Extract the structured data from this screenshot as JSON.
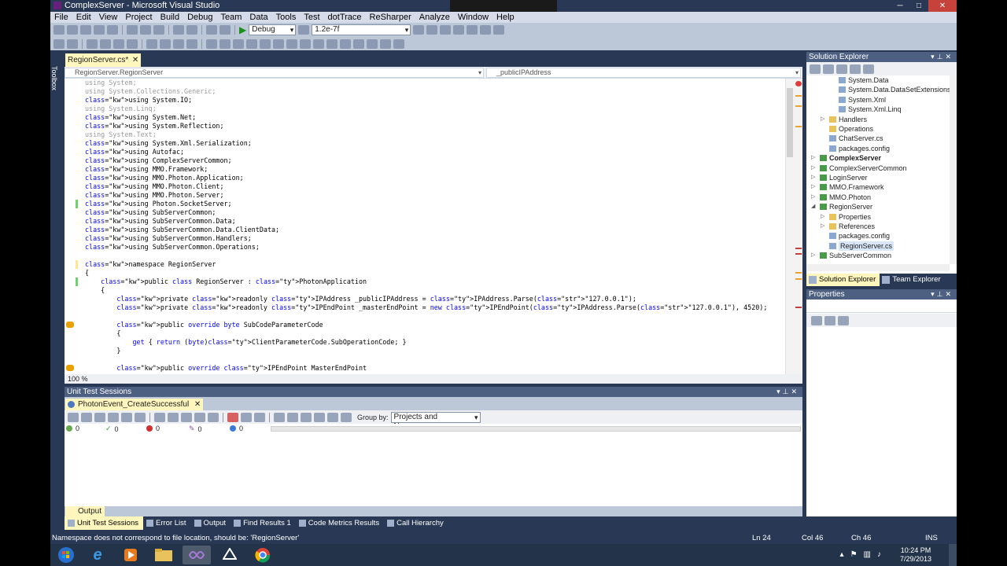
{
  "window": {
    "title": "ComplexServer - Microsoft Visual Studio"
  },
  "menu": [
    "File",
    "Edit",
    "View",
    "Project",
    "Build",
    "Debug",
    "Team",
    "Data",
    "Tools",
    "Test",
    "dotTrace",
    "ReSharper",
    "Analyze",
    "Window",
    "Help"
  ],
  "toolbar": {
    "config": "Debug",
    "search_value": "1.2e-7f"
  },
  "toolbox_label": "Toolbox",
  "editor": {
    "tab_label": "RegionServer.cs*",
    "nav_left": "RegionServer.RegionServer",
    "nav_right": "_publicIPAddress",
    "zoom": "100 %",
    "lines": [
      {
        "t": "using System;",
        "dim": true
      },
      {
        "t": "using System.Collections.Generic;",
        "dim": true
      },
      {
        "t": "using System.IO;"
      },
      {
        "t": "using System.Linq;",
        "dim": true
      },
      {
        "t": "using System.Net;"
      },
      {
        "t": "using System.Reflection;"
      },
      {
        "t": "using System.Text;",
        "dim": true
      },
      {
        "t": "using System.Xml.Serialization;"
      },
      {
        "t": "using Autofac;"
      },
      {
        "t": "using ComplexServerCommon;"
      },
      {
        "t": "using MMO.Framework;"
      },
      {
        "t": "using MMO.Photon.Application;"
      },
      {
        "t": "using MMO.Photon.Client;"
      },
      {
        "t": "using MMO.Photon.Server;"
      },
      {
        "t": "using Photon.SocketServer;"
      },
      {
        "t": "using SubServerCommon;"
      },
      {
        "t": "using SubServerCommon.Data;"
      },
      {
        "t": "using SubServerCommon.Data.ClientData;"
      },
      {
        "t": "using SubServerCommon.Handlers;"
      },
      {
        "t": "using SubServerCommon.Operations;"
      },
      {
        "t": ""
      },
      {
        "t": "namespace RegionServer"
      },
      {
        "t": "{"
      },
      {
        "t": "    public class RegionServer : PhotonApplication"
      },
      {
        "t": "    {"
      },
      {
        "t": "        private readonly IPAddress _publicIPAddress = IPAddress.Parse(\"127.0.0.1\");"
      },
      {
        "t": "        private readonly IPEndPoint _masterEndPoint = new IPEndPoint(IPAddress.Parse(\"127.0.0.1\"), 4520);"
      },
      {
        "t": ""
      },
      {
        "t": "        public override byte SubCodeParameterCode"
      },
      {
        "t": "        {"
      },
      {
        "t": "            get { return (byte)ClientParameterCode.SubOperationCode; }"
      },
      {
        "t": "        }"
      },
      {
        "t": ""
      },
      {
        "t": "        public override IPEndPoint MasterEndPoint"
      }
    ]
  },
  "unit_tests": {
    "panel_title": "Unit Test Sessions",
    "session_tab": "PhotonEvent_CreateSuccessful",
    "group_by_label": "Group by:",
    "group_by_value": "Projects and Namespaces",
    "counts": [
      {
        "name": "total",
        "value": "0",
        "color": "#6aa84f"
      },
      {
        "name": "passed",
        "value": "0",
        "color": "#2ea82e"
      },
      {
        "name": "failed",
        "value": "0",
        "color": "#d03030"
      },
      {
        "name": "ignored",
        "value": "0",
        "color": "#8a4a9a"
      },
      {
        "name": "unknown",
        "value": "0",
        "color": "#3c7bd4"
      }
    ]
  },
  "output_tab": "Output",
  "bottom_tabs": [
    "Unit Test Sessions",
    "Error List",
    "Output",
    "Find Results 1",
    "Code Metrics Results",
    "Call Hierarchy"
  ],
  "solution_explorer": {
    "title": "Solution Explorer",
    "items": [
      {
        "label": "System.Data",
        "indent": 4,
        "exp": ""
      },
      {
        "label": "System.Data.DataSetExtensions",
        "indent": 4,
        "exp": ""
      },
      {
        "label": "System.Xml",
        "indent": 4,
        "exp": ""
      },
      {
        "label": "System.Xml.Linq",
        "indent": 4,
        "exp": ""
      },
      {
        "label": "Handlers",
        "indent": 2,
        "exp": "▷"
      },
      {
        "label": "Operations",
        "indent": 2,
        "exp": ""
      },
      {
        "label": "ChatServer.cs",
        "indent": 2,
        "exp": ""
      },
      {
        "label": "packages.config",
        "indent": 2,
        "exp": ""
      },
      {
        "label": "ComplexServer",
        "indent": 0,
        "exp": "▷",
        "bold": true
      },
      {
        "label": "ComplexServerCommon",
        "indent": 0,
        "exp": "▷"
      },
      {
        "label": "LoginServer",
        "indent": 0,
        "exp": "▷"
      },
      {
        "label": "MMO.Framework",
        "indent": 0,
        "exp": "▷"
      },
      {
        "label": "MMO.Photon",
        "indent": 0,
        "exp": "▷"
      },
      {
        "label": "RegionServer",
        "indent": 0,
        "exp": "◢"
      },
      {
        "label": "Properties",
        "indent": 2,
        "exp": "▷"
      },
      {
        "label": "References",
        "indent": 2,
        "exp": "▷"
      },
      {
        "label": "packages.config",
        "indent": 2,
        "exp": ""
      },
      {
        "label": "RegionServer.cs",
        "indent": 2,
        "exp": "",
        "sel": true
      },
      {
        "label": "SubServerCommon",
        "indent": 0,
        "exp": "▷"
      }
    ],
    "tabs": [
      "Solution Explorer",
      "Team Explorer"
    ]
  },
  "properties": {
    "title": "Properties"
  },
  "status": {
    "message": "Namespace does not correspond to file location, should be: 'RegionServer'",
    "ln": "Ln 24",
    "col": "Col 46",
    "ch": "Ch 46",
    "ins": "INS"
  },
  "taskbar": {
    "time": "10:24 PM",
    "date": "7/29/2013"
  }
}
